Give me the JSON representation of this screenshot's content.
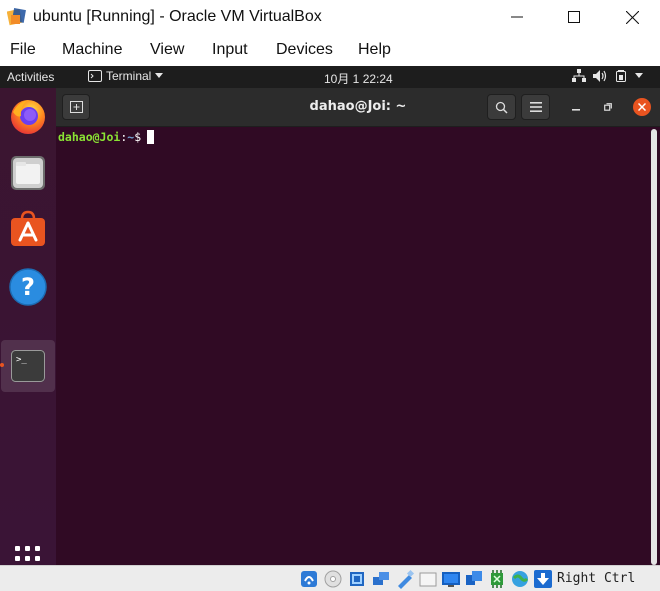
{
  "window": {
    "title": "ubuntu [Running] - Oracle VM VirtualBox"
  },
  "menubar": {
    "items": [
      "File",
      "Machine",
      "View",
      "Input",
      "Devices",
      "Help"
    ]
  },
  "guest_topbar": {
    "activities": "Activities",
    "app_menu": "Terminal",
    "clock": "10月 1  22:24"
  },
  "dock": {
    "apps": [
      {
        "name": "firefox-icon",
        "running": false
      },
      {
        "name": "files-icon",
        "running": false
      },
      {
        "name": "software-center-icon",
        "running": false
      },
      {
        "name": "help-icon",
        "running": false
      },
      {
        "name": "terminal-icon",
        "running": true
      }
    ],
    "terminal_glyph": ">_",
    "help_glyph": "?"
  },
  "terminal": {
    "title": "dahao@Joi: ~",
    "prompt_user": "dahao@Joi",
    "prompt_sep": ":",
    "prompt_path": "~",
    "prompt_dollar": "$"
  },
  "statusbar": {
    "host_key": "Right Ctrl",
    "icons": [
      "hard-disk-icon",
      "optical-drive-icon",
      "audio-icon",
      "network-icon",
      "usb-icon",
      "shared-folders-icon",
      "display-icon",
      "video-capture-icon",
      "cpu-icon",
      "mouse-integration-icon",
      "host-key-arrow-icon"
    ]
  },
  "colors": {
    "terminal_bg": "#300a24",
    "ubuntu_orange": "#e95420",
    "prompt_user": "#8ae234",
    "prompt_path": "#729fcf"
  }
}
